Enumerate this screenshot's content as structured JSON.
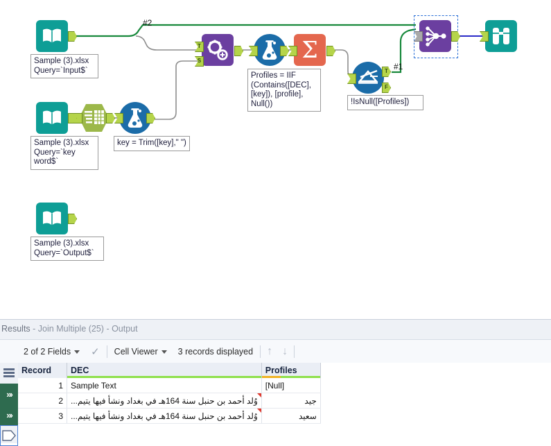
{
  "app": "Alteryx Designer workflow canvas",
  "canvas": {
    "tools": [
      {
        "id": "input-1",
        "name": "Input Data (Input$)",
        "type": "input-data",
        "annotation": "Sample (3).xlsx\nQuery=`Input$`"
      },
      {
        "id": "input-2",
        "name": "Input Data (key word$)",
        "type": "input-data",
        "annotation": "Sample (3).xlsx\nQuery=`key word$`"
      },
      {
        "id": "input-3",
        "name": "Input Data (Output$)",
        "type": "input-data",
        "annotation": "Sample (3).xlsx\nQuery=`Output$`"
      },
      {
        "id": "select-1",
        "name": "Select",
        "type": "select",
        "annotation": ""
      },
      {
        "id": "formula-1",
        "name": "Formula",
        "type": "formula",
        "annotation": "key = Trim([key],\" \")"
      },
      {
        "id": "findreplace-1",
        "name": "Find Replace",
        "type": "find-replace",
        "annotation": "",
        "inputs": [
          "T",
          "S"
        ]
      },
      {
        "id": "formula-2",
        "name": "Formula",
        "type": "formula",
        "annotation": "Profiles = IIF\n(Contains([DEC],\n[key]), [profile],\nNull())"
      },
      {
        "id": "summarize-1",
        "name": "Summarize",
        "type": "summarize",
        "annotation": ""
      },
      {
        "id": "filter-1",
        "name": "Filter",
        "type": "filter",
        "annotation": "!IsNull([Profiles])",
        "outputs": [
          "T",
          "F"
        ]
      },
      {
        "id": "joinmultiple-1",
        "name": "Join Multiple",
        "type": "join-multiple",
        "annotation": "",
        "selected": true
      },
      {
        "id": "browse-1",
        "name": "Browse",
        "type": "browse",
        "annotation": ""
      }
    ],
    "wire_labels": [
      {
        "text": "#2"
      },
      {
        "text": "#1"
      }
    ],
    "annotations": {
      "input1": "Sample (3).xlsx\nQuery=`Input$`",
      "input2": "Sample (3).xlsx\nQuery=`key word$`",
      "input3": "Sample (3).xlsx\nQuery=`Output$`",
      "formula_trim": "key = Trim([key],\" \")",
      "formula_profiles": "Profiles = IIF\n(Contains([DEC],\n[key]), [profile],\nNull())",
      "filter_expr": "!IsNull([Profiles])"
    },
    "colors": {
      "input_teal": "#0e9e96",
      "select_green": "#9cb84a",
      "formula_blue": "#1b6ca8",
      "findreplace_purple": "#6b3fa0",
      "summarize_salmon": "#e4674e",
      "join_purple": "#6b3fa0",
      "browse_teal": "#0e9e96",
      "wire_green": "#17883b",
      "wire_gray": "#8d8d8d",
      "wire_blue": "#2b2bc8",
      "selection_blue": "#2a6fd6"
    }
  },
  "results": {
    "title_prefix": "Results",
    "title_rest": " - Join Multiple (25) - Output",
    "toolbar": {
      "fields_label": "2 of 2 Fields",
      "check_icon": "check-icon",
      "viewer_label": "Cell Viewer",
      "records_label": "3 records displayed",
      "up_arrow": "↑",
      "down_arrow": "↓"
    },
    "rail": {
      "list_icon": "list-icon",
      "anchor_icon_1": "anchor-chevrons-icon",
      "anchor_icon_2": "anchor-chevrons-icon",
      "output_icon": "output-pentagon-icon"
    },
    "grid": {
      "columns": [
        "Record",
        "DEC",
        "Profiles"
      ],
      "rows": [
        {
          "record": "1",
          "dec": "Sample Text",
          "profiles": "[Null]",
          "dec_flag": false,
          "profiles_null": true
        },
        {
          "record": "2",
          "dec": "وُلد أحمد بن حنبل سنة 164هـ في بغداد ونشأ فيها يتيم...",
          "profiles": "جيد",
          "dec_flag": true,
          "profiles_null": false
        },
        {
          "record": "3",
          "dec": "وُلد أحمد بن حنبل سنة 164هـ في بغداد ونشأ فيها يتيم...",
          "profiles": "سعيد",
          "dec_flag": true,
          "profiles_null": false
        }
      ]
    }
  }
}
